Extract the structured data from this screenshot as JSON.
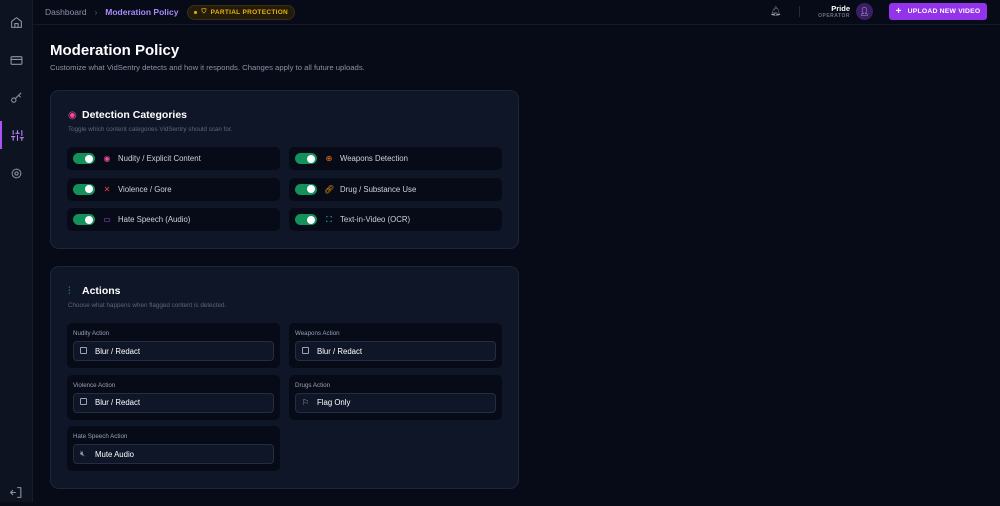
{
  "sidebar": {
    "items": [
      {
        "name": "home",
        "icon": "home-icon"
      },
      {
        "name": "billing",
        "icon": "credit-card-icon"
      },
      {
        "name": "keys",
        "icon": "key-icon"
      },
      {
        "name": "moderation",
        "icon": "sliders-icon",
        "active": true
      },
      {
        "name": "settings",
        "icon": "gear-icon"
      }
    ],
    "logout_icon": "logout-icon"
  },
  "header": {
    "breadcrumb": [
      "Dashboard",
      "Moderation Policy"
    ],
    "badge": "PARTIAL PROTECTION",
    "user_name": "Pride",
    "user_role": "OPERATOR",
    "upload_label": "UPLOAD NEW VIDEO"
  },
  "page": {
    "title": "Moderation Policy",
    "subtitle": "Customize what VidSentry detects and how it responds. Changes apply to all future uploads."
  },
  "detection": {
    "title": "Detection Categories",
    "desc": "Toggle which content categories VidSentry should scan for.",
    "items": [
      {
        "label": "Nudity / Explicit Content",
        "on": true,
        "icon": "eye-icon"
      },
      {
        "label": "Weapons Detection",
        "on": true,
        "icon": "crosshair-icon"
      },
      {
        "label": "Violence / Gore",
        "on": true,
        "icon": "swords-icon"
      },
      {
        "label": "Drug / Substance Use",
        "on": true,
        "icon": "pill-icon"
      },
      {
        "label": "Hate Speech (Audio)",
        "on": true,
        "icon": "message-icon"
      },
      {
        "label": "Text-in-Video (OCR)",
        "on": true,
        "icon": "scan-text-icon"
      }
    ]
  },
  "actions": {
    "title": "Actions",
    "desc": "Choose what happens when flagged content is detected.",
    "items": [
      {
        "label": "Nudity Action",
        "value": "Blur / Redact"
      },
      {
        "label": "Weapons Action",
        "value": "Blur / Redact"
      },
      {
        "label": "Violence Action",
        "value": "Blur / Redact"
      },
      {
        "label": "Drugs Action",
        "value": "Flag Only"
      },
      {
        "label": "Hate Speech Action",
        "value": "Mute Audio"
      }
    ]
  },
  "colors": {
    "accent": "#9333ea",
    "toggle_on": "#14915a",
    "warning": "#eab308"
  }
}
